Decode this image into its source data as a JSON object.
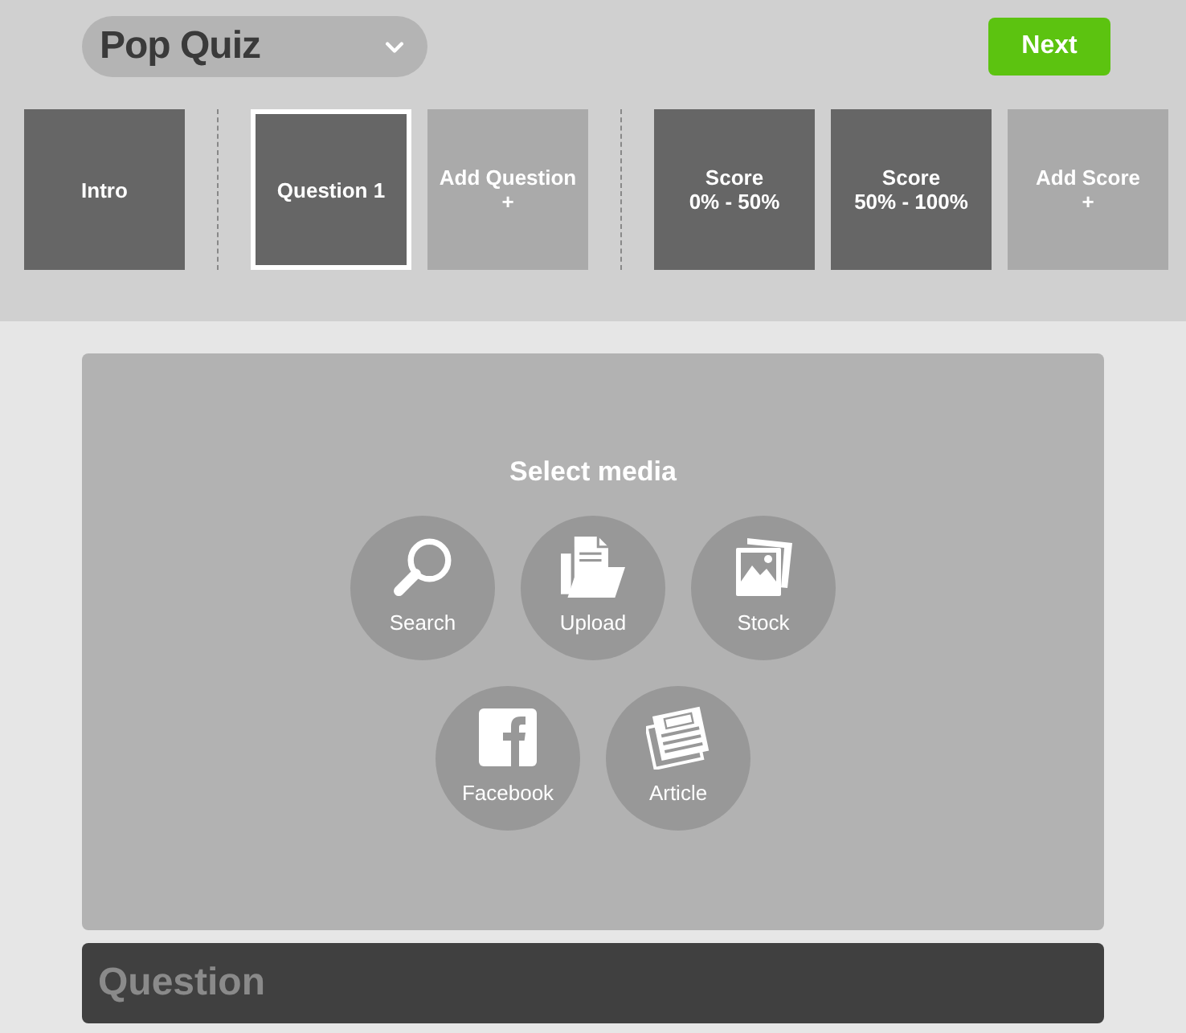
{
  "quiz_selector": {
    "title": "Pop Quiz"
  },
  "next_button": {
    "label": "Next"
  },
  "slide_groups": [
    [
      {
        "kind": "slide",
        "lines": [
          "Intro"
        ],
        "selected": false
      }
    ],
    [
      {
        "kind": "slide",
        "lines": [
          "Question 1"
        ],
        "selected": true
      },
      {
        "kind": "add",
        "lines": [
          "Add Question",
          "+"
        ],
        "selected": false
      }
    ],
    [
      {
        "kind": "slide",
        "lines": [
          "Score",
          "0% - 50%"
        ],
        "selected": false
      },
      {
        "kind": "slide",
        "lines": [
          "Score",
          "50% - 100%"
        ],
        "selected": false
      },
      {
        "kind": "add",
        "lines": [
          "Add Score",
          "+"
        ],
        "selected": false
      }
    ]
  ],
  "media_panel": {
    "heading": "Select media",
    "options": [
      {
        "kind": "search",
        "label": "Search"
      },
      {
        "kind": "upload",
        "label": "Upload"
      },
      {
        "kind": "stock",
        "label": "Stock"
      },
      {
        "kind": "facebook",
        "label": "Facebook"
      },
      {
        "kind": "article",
        "label": "Article"
      }
    ]
  },
  "question_field": {
    "placeholder": "Question"
  }
}
